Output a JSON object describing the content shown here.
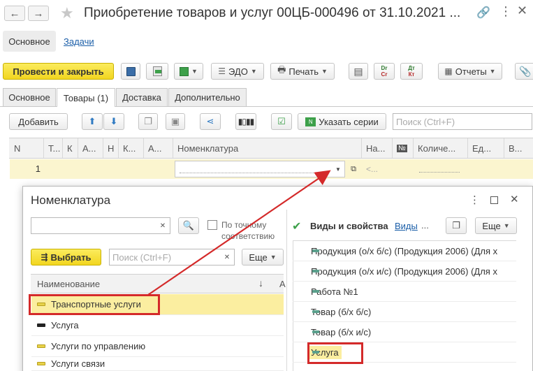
{
  "window": {
    "title": "Приобретение товаров и услуг 00ЦБ-000496 от 31.10.2021 ..."
  },
  "nav_tabs": [
    "Основное",
    "Задачи"
  ],
  "toolbar": {
    "post_close": "Провести и закрыть",
    "edo": "ЭДО",
    "print": "Печать",
    "reports": "Отчеты",
    "dt_label": "Dr",
    "dt_sub": "Cr",
    "dtkt_label": "Дт",
    "dtkt_sub": "Кт"
  },
  "tabs": [
    "Основное",
    "Товары (1)",
    "Доставка",
    "Дополнительно"
  ],
  "goods_toolbar": {
    "add": "Добавить",
    "specify_series": "Указать серии",
    "search_placeholder": "Поиск (Ctrl+F)",
    "n_icon_label": "N"
  },
  "table": {
    "headers": [
      "N",
      "Т...",
      "К",
      "А...",
      "Н",
      "К...",
      "А...",
      "Номенклатура",
      "На...",
      "№",
      "Количе...",
      "Ед...",
      "В..."
    ],
    "row": {
      "num": "1",
      "na_value": "<..."
    }
  },
  "dialog": {
    "title": "Номенклатура",
    "exact_match": "По точному соответствию",
    "select_btn": "Выбрать",
    "search_placeholder": "Поиск (Ctrl+F)",
    "more": "Еще",
    "col_name": "Наименование",
    "col_sort": "↓",
    "col_a": "А",
    "items": [
      "Транспортные услуги",
      "Услуга",
      "Услуги по управлению",
      "Услуги связи"
    ],
    "right_header": "Виды и свойства",
    "right_link": "Виды",
    "right_more": "Еще",
    "right_items": [
      "Продукция (о/х б/с) (Продукция 2006) (Для х",
      "Продукция (о/х и/с) (Продукция 2006) (Для х",
      "Работа №1",
      "Товар (б/х б/с)",
      "Товар (б/х и/с)",
      "Услуга"
    ]
  },
  "colors": {
    "accent_yellow": "#f2d620",
    "highlight_red": "#d42a2a",
    "selected_row": "#fbeea0"
  }
}
